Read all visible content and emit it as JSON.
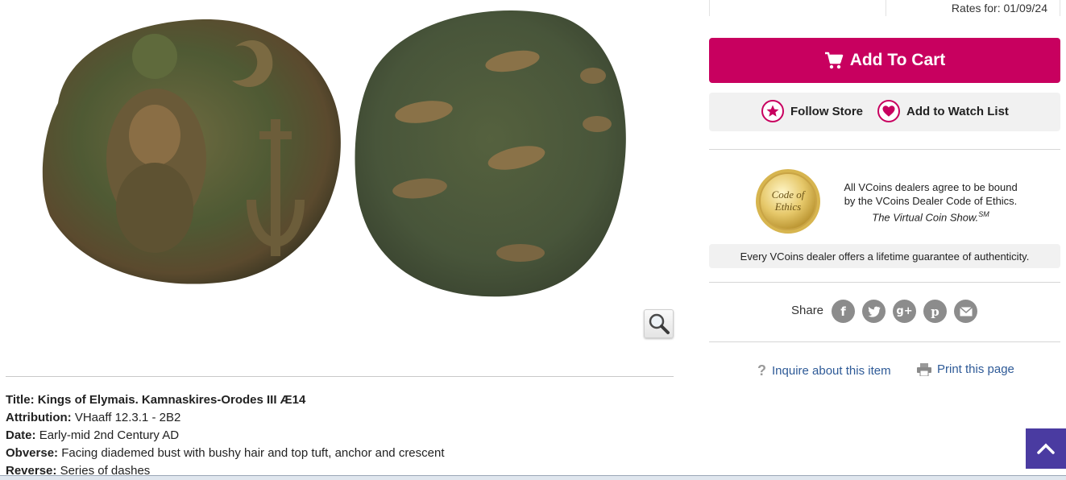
{
  "rates": {
    "text": "Rates for: 01/09/24"
  },
  "buttons": {
    "add_to_cart": "Add To Cart",
    "follow_store": "Follow Store",
    "watch_list": "Add to Watch List"
  },
  "ethics": {
    "seal_line1": "Code of",
    "seal_line2": "Ethics",
    "line1": "All VCoins dealers agree to be bound",
    "line2": "by the VCoins Dealer Code of Ethics.",
    "line3": "The Virtual Coin Show.",
    "line3_sup": "SM"
  },
  "guarantee": "Every VCoins dealer offers a lifetime guarantee of authenticity.",
  "share": {
    "label": "Share",
    "icons": [
      "facebook-icon",
      "twitter-icon",
      "google-plus-icon",
      "pinterest-icon",
      "email-icon"
    ]
  },
  "links": {
    "inquire": "Inquire about this item",
    "print": "Print this page"
  },
  "details": {
    "title_label": "Title:",
    "title_value": "Kings of Elymais. Kamnaskires-Orodes III Æ14",
    "attribution_label": "Attribution:",
    "attribution_value": "VHaaff 12.3.1 - 2B2",
    "date_label": "Date:",
    "date_value": "Early-mid 2nd Century AD",
    "obverse_label": "Obverse:",
    "obverse_value": "Facing diademed bust with bushy hair and top tuft, anchor and crescent",
    "reverse_label": "Reverse:",
    "reverse_value": "Series of dashes"
  },
  "colors": {
    "accent": "#c8005f",
    "link": "#2e5a97",
    "back_to_top": "#4a3ba1"
  }
}
